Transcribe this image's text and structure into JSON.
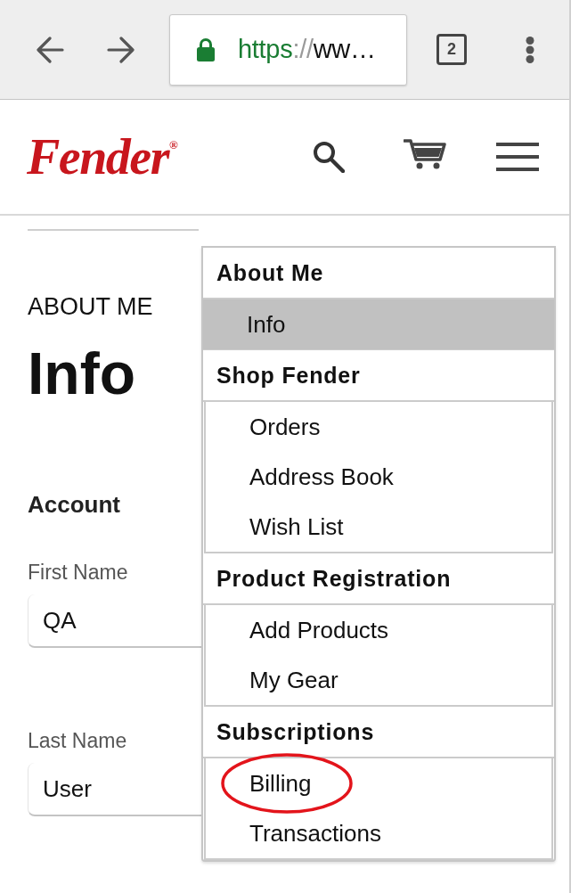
{
  "browser": {
    "url": {
      "scheme": "https",
      "separator": "://",
      "rest": "ww…"
    },
    "tab_count": "2"
  },
  "site_header": {
    "logo": {
      "text": "Fender",
      "mark": "®"
    }
  },
  "page": {
    "section_label": "ABOUT ME",
    "title": "Info",
    "group_title": "Account",
    "fields": [
      {
        "label": "First Name",
        "value": "QA"
      },
      {
        "label": "Last Name",
        "value": "User"
      }
    ]
  },
  "menu": {
    "sections": [
      {
        "title": "About Me",
        "items": [
          {
            "label": "Info",
            "selected": true,
            "circled": false
          }
        ]
      },
      {
        "title": "Shop Fender",
        "items": [
          {
            "label": "Orders",
            "selected": false,
            "circled": false
          },
          {
            "label": "Address Book",
            "selected": false,
            "circled": false
          },
          {
            "label": "Wish List",
            "selected": false,
            "circled": false
          }
        ]
      },
      {
        "title": "Product Registration",
        "items": [
          {
            "label": "Add Products",
            "selected": false,
            "circled": false
          },
          {
            "label": "My Gear",
            "selected": false,
            "circled": false
          }
        ]
      },
      {
        "title": "Subscriptions",
        "items": [
          {
            "label": "Billing",
            "selected": false,
            "circled": true
          },
          {
            "label": "Transactions",
            "selected": false,
            "circled": false
          }
        ]
      }
    ]
  }
}
